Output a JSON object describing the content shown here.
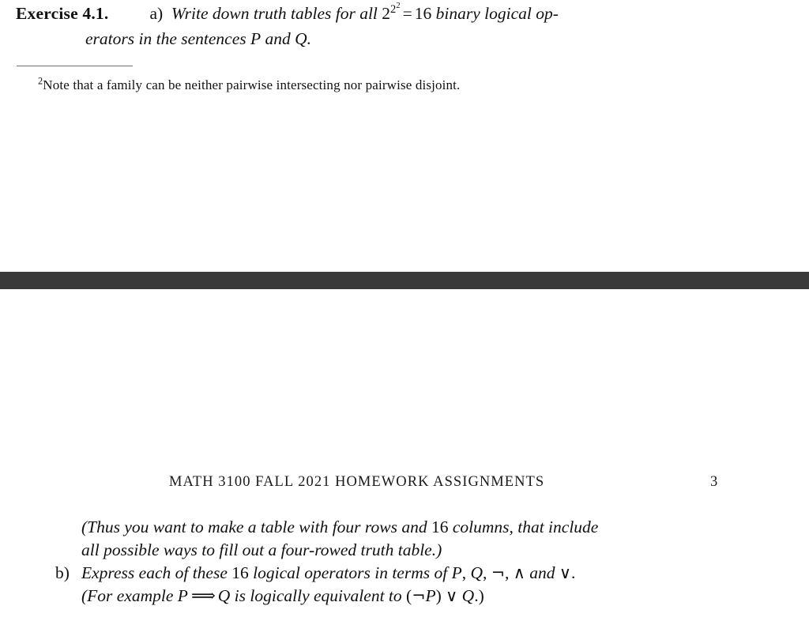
{
  "document": {
    "type": "scanned-math-homework-pdf",
    "background_color": "#ffffff",
    "text_color": "#111111"
  },
  "top_fragment": {
    "exercise": {
      "label": "Exercise 4.1.",
      "item_letter": "a)",
      "line1_before_math": "Write down truth tables for all",
      "math_base": "2",
      "math_exp_outer": "2",
      "math_exp_inner": "2",
      "math_equals": "=",
      "math_result": "16",
      "line1_after_math": "binary logical op-",
      "line2_part1": "erators in the sentences",
      "line2_var_p": "P",
      "line2_and": "and",
      "line2_var_q": "Q",
      "line2_end": "."
    },
    "footnote": {
      "marker": "2",
      "text": "Note that a family can be neither pairwise intersecting nor pairwise disjoint.",
      "rule_color": "#6f6f6f"
    }
  },
  "separator_bar": {
    "color": "#3a3a3a",
    "label": "scan-separator-bar"
  },
  "bottom_fragment": {
    "running_head": {
      "title": "MATH 3100 FALL 2021 HOMEWORK ASSIGNMENTS",
      "page_number": "3"
    },
    "body": {
      "line1_a": "(Thus you want to make a table with four rows and",
      "line1_num": "16",
      "line1_b": "columns, that include",
      "line2": "all possible ways to fill out a four-rowed truth table.)",
      "item_letter": "b)",
      "line3_a": "Express each of these",
      "line3_num": "16",
      "line3_b": "logical operators in terms of",
      "line3_var_p": "P",
      "line3_comma1": ",",
      "line3_var_q": "Q",
      "line3_comma2": ",",
      "line3_not": "¬",
      "line3_comma3": ",",
      "line3_and_sym": "∧",
      "line3_and_word": "and",
      "line3_or_sym": "∨",
      "line3_period": ".",
      "line4_a": "(For example",
      "line4_var_p": "P",
      "line4_implies": "⟹",
      "line4_var_q": "Q",
      "line4_b": "is logically equivalent to",
      "line4_expr_open": "(",
      "line4_expr_not": "¬",
      "line4_expr_p": "P",
      "line4_expr_close": ")",
      "line4_expr_or": "∨",
      "line4_expr_q": "Q",
      "line4_expr_end": ".)"
    }
  }
}
